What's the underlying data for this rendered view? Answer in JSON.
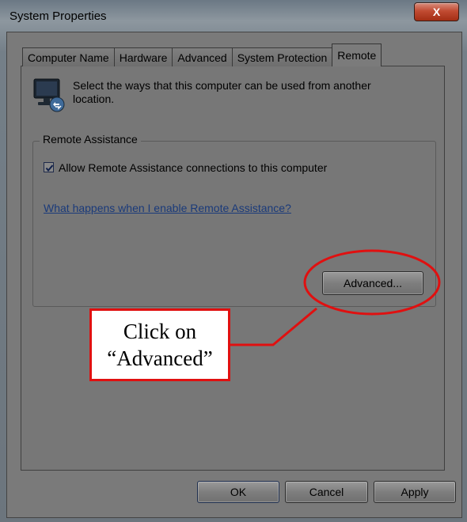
{
  "window": {
    "title": "System Properties",
    "close_label": "X"
  },
  "tabs": [
    {
      "label": "Computer Name"
    },
    {
      "label": "Hardware"
    },
    {
      "label": "Advanced"
    },
    {
      "label": "System Protection"
    },
    {
      "label": "Remote",
      "active": true
    }
  ],
  "intro": {
    "text": "Select the ways that this computer can be used from another location.",
    "icon": "remote-monitor-icon"
  },
  "remote_assistance": {
    "legend": "Remote Assistance",
    "checkbox_label": "Allow Remote Assistance connections to this computer",
    "checked": true,
    "help_link": "What happens when I enable Remote Assistance?",
    "advanced_button": "Advanced..."
  },
  "footer": {
    "ok": "OK",
    "cancel": "Cancel",
    "apply": "Apply"
  },
  "annotation": {
    "line1": "Click on",
    "line2": "“Advanced”",
    "color": "#e01010"
  }
}
